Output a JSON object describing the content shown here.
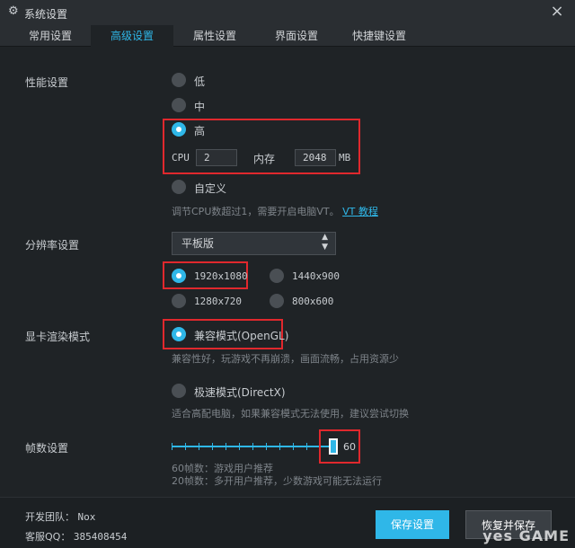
{
  "window": {
    "title": "系统设置",
    "close_glyph": "×"
  },
  "tabs": [
    {
      "label": "常用设置",
      "active": false
    },
    {
      "label": "高级设置",
      "active": true
    },
    {
      "label": "属性设置",
      "active": false
    },
    {
      "label": "界面设置",
      "active": false
    },
    {
      "label": "快捷键设置",
      "active": false
    }
  ],
  "performance": {
    "label": "性能设置",
    "options": [
      "低",
      "中",
      "高",
      "自定义"
    ],
    "selected": "高",
    "cpu_label": "CPU",
    "cpu_value": "2",
    "memory_label": "内存",
    "memory_value": "2048",
    "memory_unit": "MB",
    "hint": "调节CPU数超过1，需要开启电脑VT。",
    "hint_link": "VT 教程"
  },
  "resolution": {
    "label": "分辨率设置",
    "dropdown_value": "平板版",
    "options": [
      "1920x1080",
      "1440x900",
      "1280x720",
      "800x600"
    ],
    "selected": "1920x1080"
  },
  "render": {
    "label": "显卡渲染模式",
    "compat_label": "兼容模式(OpenGL)",
    "compat_hint": "兼容性好，玩游戏不再崩溃，画面流畅，占用资源少",
    "speed_label": "极速模式(DirectX)",
    "speed_hint": "适合高配电脑，如果兼容模式无法使用，建议尝试切换",
    "selected": "兼容模式(OpenGL)"
  },
  "fps": {
    "label": "帧数设置",
    "value": "60",
    "fraction": 1.0,
    "hint1": "60帧数：游戏用户推荐",
    "hint2": "20帧数：多开用户推荐，少数游戏可能无法运行"
  },
  "footer": {
    "team_label": "开发团队：",
    "team_value": "Nox",
    "qq_label": "客服QQ：",
    "qq_value": "385408454",
    "save_label": "保存设置",
    "restore_label": "恢复并保存"
  },
  "watermark": "yes GAME",
  "colors": {
    "accent": "#2fb7e8",
    "highlight": "#e0282d",
    "background": "#1f2326"
  }
}
